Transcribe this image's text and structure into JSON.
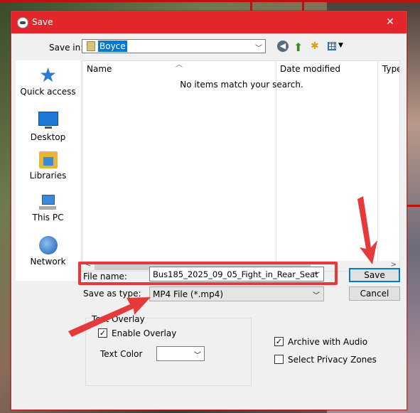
{
  "window": {
    "title": "Save",
    "close_glyph": "✕"
  },
  "toolbar": {
    "save_in_label": "Save in:",
    "save_in_value": "Boyce",
    "back_glyph": "◀",
    "up_glyph": "⬆",
    "new_folder_glyph": "✱"
  },
  "places": [
    {
      "label": "Quick access",
      "icon": "star-icon"
    },
    {
      "label": "Desktop",
      "icon": "desktop-icon"
    },
    {
      "label": "Libraries",
      "icon": "libraries-icon"
    },
    {
      "label": "This PC",
      "icon": "computer-icon"
    },
    {
      "label": "Network",
      "icon": "network-icon"
    }
  ],
  "file_list": {
    "columns": [
      "Name",
      "Date modified",
      "Type"
    ],
    "empty_message": "No items match your search."
  },
  "fields": {
    "file_name_label": "File name:",
    "file_name_value": "Bus185_2025_09_05_Fight_in_Rear_Seat",
    "save_as_type_label": "Save as type:",
    "save_as_type_value": "MP4 File (*.mp4)"
  },
  "buttons": {
    "save": "Save",
    "cancel": "Cancel"
  },
  "overlay": {
    "group_title": "Text Overlay",
    "enable_label": "Enable Overlay",
    "enable_checked": true,
    "text_color_label": "Text Color",
    "text_color_value": ""
  },
  "options": {
    "archive_audio_label": "Archive with Audio",
    "archive_audio_checked": true,
    "privacy_zones_label": "Select Privacy Zones",
    "privacy_zones_checked": false
  },
  "colors": {
    "title_bar": "#e3262b",
    "annotation_red": "#e63a3a",
    "selection_blue": "#0078d7"
  }
}
